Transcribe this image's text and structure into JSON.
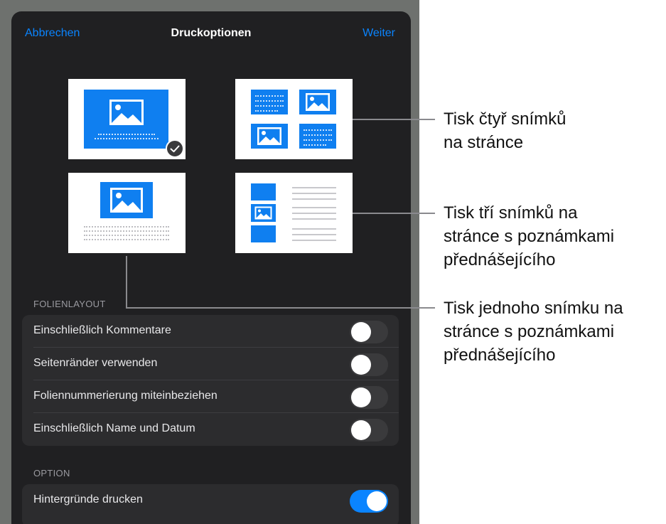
{
  "nav": {
    "cancel": "Abbrechen",
    "title": "Druckoptionen",
    "next": "Weiter"
  },
  "layouts": [
    {
      "id": "single-slide",
      "selected": true
    },
    {
      "id": "four-slides",
      "selected": false
    },
    {
      "id": "one-slide-notes",
      "selected": false
    },
    {
      "id": "three-slides-notes",
      "selected": false
    }
  ],
  "sections": {
    "slide_layout": {
      "header": "FOLIENLAYOUT",
      "rows": [
        {
          "label": "Einschließlich Kommentare",
          "on": false
        },
        {
          "label": "Seitenränder verwenden",
          "on": false
        },
        {
          "label": "Foliennummerierung miteinbeziehen",
          "on": false
        },
        {
          "label": "Einschließlich Name und Datum",
          "on": false
        }
      ]
    },
    "options": {
      "header": "OPTION",
      "rows": [
        {
          "label": "Hintergründe drucken",
          "on": true
        }
      ]
    }
  },
  "callouts": {
    "four": "Tisk čtyř snímků\nna stránce",
    "three": "Tisk tří snímků na\nstránce s poznámkami\npřednášejícího",
    "one": "Tisk jednoho snímku na\nstránce s poznámkami\npřednášejícího"
  },
  "colors": {
    "accent": "#0a84ff",
    "slide_blue": "#0f7ff0",
    "sheet_bg": "#202022"
  }
}
